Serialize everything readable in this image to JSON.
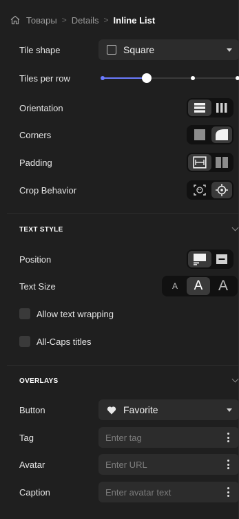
{
  "breadcrumb": {
    "items": [
      "Товары",
      "Details"
    ],
    "current": "Inline List"
  },
  "layout": {
    "tile_shape": {
      "label": "Tile shape",
      "value": "Square"
    },
    "tiles_per_row": {
      "label": "Tiles per row",
      "value_fraction": 0.34,
      "stops": 4
    },
    "orientation": {
      "label": "Orientation",
      "selected": "rows"
    },
    "corners": {
      "label": "Corners",
      "selected": "rounded"
    },
    "padding": {
      "label": "Padding",
      "selected": "padded"
    },
    "crop_behavior": {
      "label": "Crop Behavior",
      "selected": "focal-point"
    }
  },
  "text_style": {
    "title": "TEXT STYLE",
    "position": {
      "label": "Position",
      "selected": "below"
    },
    "text_size": {
      "label": "Text Size",
      "options": [
        "A",
        "A",
        "A"
      ],
      "selected_index": 1
    },
    "allow_wrapping": {
      "label": "Allow text wrapping",
      "checked": false
    },
    "all_caps": {
      "label": "All-Caps titles",
      "checked": false
    }
  },
  "overlays": {
    "title": "OVERLAYS",
    "button": {
      "label": "Button",
      "value": "Favorite"
    },
    "tag": {
      "label": "Tag",
      "placeholder": "Enter tag"
    },
    "avatar": {
      "label": "Avatar",
      "placeholder": "Enter URL"
    },
    "caption": {
      "label": "Caption",
      "placeholder": "Enter avatar text"
    }
  },
  "colors": {
    "background": "#1f1f1f",
    "control": "#2c2c2c",
    "accent": "#6b7bff"
  }
}
